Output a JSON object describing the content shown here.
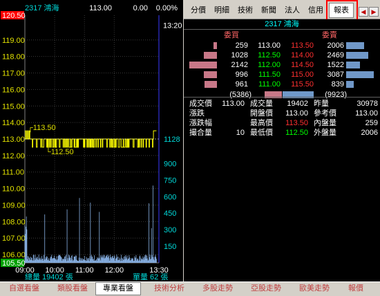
{
  "header": {
    "code_name": "2317 鴻海",
    "price": "113.00",
    "change": "0.00",
    "pct": "0.00%"
  },
  "chart": {
    "price_axis": [
      "120.50",
      "119.00",
      "118.00",
      "117.00",
      "116.00",
      "115.00",
      "114.00",
      "113.00",
      "112.00",
      "111.00",
      "110.00",
      "109.00",
      "108.00",
      "107.00",
      "106.00",
      "105.50"
    ],
    "price_axis_highlight": {
      "top": "120.50",
      "bottom": "105.50"
    },
    "volume_axis": [
      "1128",
      "900",
      "750",
      "600",
      "450",
      "300",
      "150"
    ],
    "time_labels": [
      "09:00",
      "10:00",
      "11:00",
      "12:00",
      "13:30"
    ],
    "end_time_label": "13:20",
    "high_label": "113.50",
    "low_label": "112.50",
    "total_volume": "總量 19402 張",
    "unit_volume": "單量 62 張"
  },
  "chart_data": {
    "type": "line",
    "title": "",
    "xlabel": "",
    "ylabel": "",
    "ylim": [
      105.5,
      120.5
    ],
    "series": [
      {
        "x": [
          "09:00",
          "09:05",
          "09:15",
          "09:30",
          "10:00",
          "10:30",
          "11:00",
          "11:30",
          "12:00",
          "12:30",
          "13:00",
          "13:20"
        ],
        "values": [
          113.0,
          113.5,
          112.5,
          113.0,
          112.5,
          113.0,
          112.5,
          113.0,
          112.5,
          113.0,
          112.5,
          113.5
        ]
      }
    ]
  },
  "tabs": [
    {
      "label": "分價"
    },
    {
      "label": "明細"
    },
    {
      "label": "技術"
    },
    {
      "label": "新聞"
    },
    {
      "label": "法人"
    },
    {
      "label": "信用"
    },
    {
      "label": "報表"
    }
  ],
  "nav": {
    "prev": "◀",
    "next": "▶"
  },
  "stock_title": "2317 鴻海",
  "orderbook": {
    "bid_header": "委買",
    "ask_header": "委賣",
    "rows": [
      {
        "bid_vol": "259",
        "bid_price": "113.00",
        "ask_price": "113.50",
        "ask_vol": "2006",
        "bid_ratio": 0.12,
        "ask_ratio": 0.54
      },
      {
        "bid_vol": "1028",
        "bid_price": "112.50",
        "ask_price": "114.00",
        "ask_vol": "2469",
        "bid_ratio": 0.43,
        "ask_ratio": 0.66
      },
      {
        "bid_vol": "2142",
        "bid_price": "112.00",
        "ask_price": "114.50",
        "ask_vol": "1522",
        "bid_ratio": 0.9,
        "ask_ratio": 0.41
      },
      {
        "bid_vol": "996",
        "bid_price": "111.50",
        "ask_price": "115.00",
        "ask_vol": "3087",
        "bid_ratio": 0.42,
        "ask_ratio": 0.83
      },
      {
        "bid_vol": "961",
        "bid_price": "111.00",
        "ask_price": "115.50",
        "ask_vol": "839",
        "bid_ratio": 0.4,
        "ask_ratio": 0.23
      }
    ],
    "bid_total": "(5386)",
    "ask_total": "(9923)"
  },
  "quote": {
    "rows": [
      {
        "l1": "成交價",
        "v1": "113.00",
        "l2": "成交量",
        "v2": "19402",
        "l3": "昨量",
        "v3": "30978",
        "c2": "#ffffff"
      },
      {
        "l1": "漲跌",
        "v1": "",
        "l2": "開盤價",
        "v2": "113.00",
        "l3": "參考價",
        "v3": "113.00",
        "c2": "#ffffff"
      },
      {
        "l1": "漲跌幅",
        "v1": "",
        "l2": "最高價",
        "v2": "113.50",
        "l3": "內盤量",
        "v3": "259",
        "c2": "#ff3030"
      },
      {
        "l1": "撮合量",
        "v1": "10",
        "l2": "最低價",
        "v2": "112.50",
        "l3": "外盤量",
        "v3": "2006",
        "c2": "#00ff00"
      }
    ]
  },
  "bottom_tabs": [
    {
      "label": "自選看盤"
    },
    {
      "label": "類股看盤"
    },
    {
      "label": "專業看盤"
    },
    {
      "label": "技術分析"
    },
    {
      "label": "多股走勢"
    },
    {
      "label": "亞股走勢"
    },
    {
      "label": "歐美走勢"
    },
    {
      "label": "報價"
    }
  ],
  "colors": {
    "up": "#ff3030",
    "down": "#00ff00",
    "flat": "#ffffff",
    "line": "#ffff00",
    "volume": "#8ab4e8",
    "axis_text": "#00d8d8",
    "bid_bar": "#c87888",
    "ask_bar": "#7098c8"
  }
}
